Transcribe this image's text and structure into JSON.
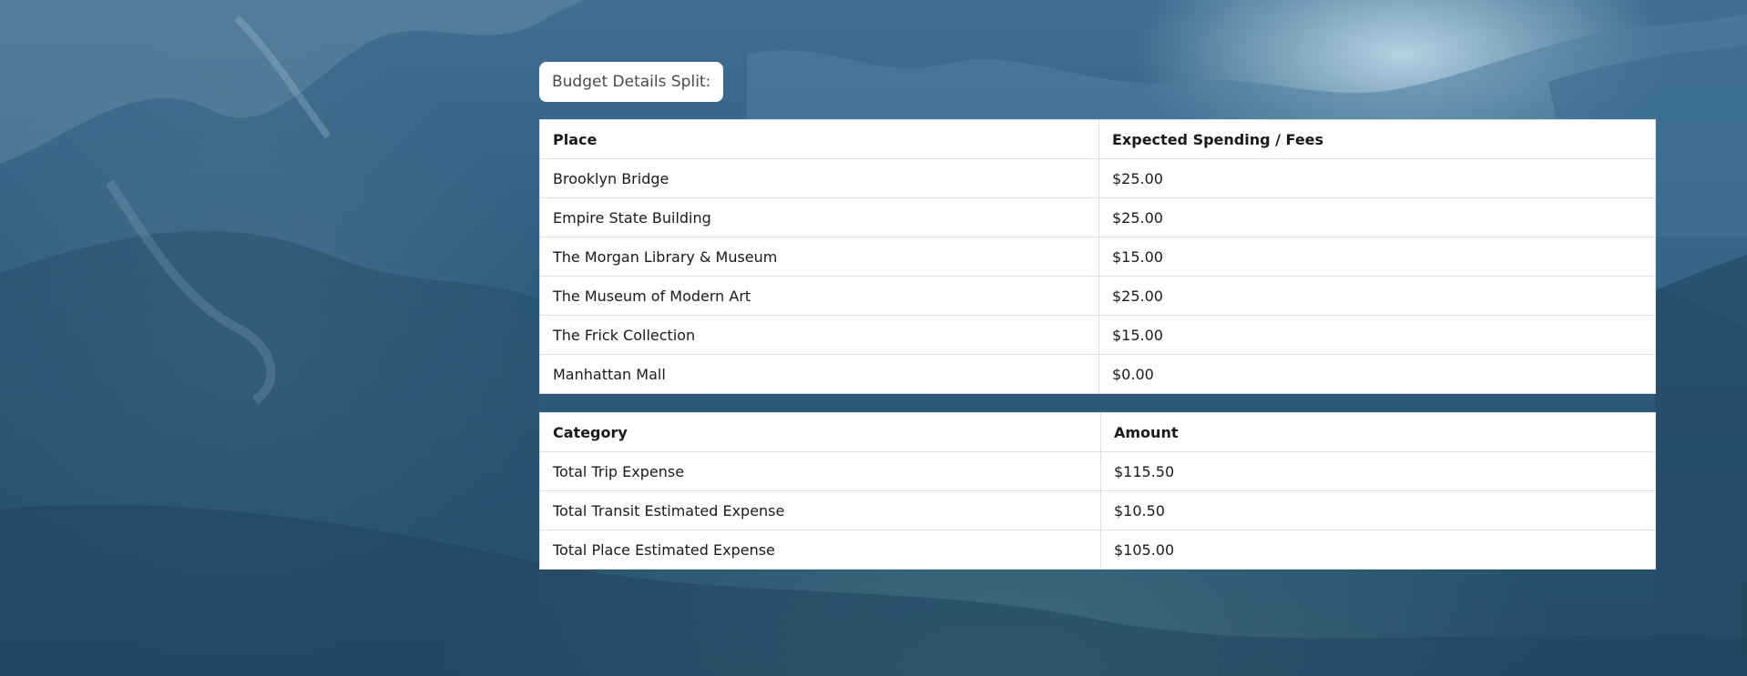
{
  "budget_label": "Budget Details Split:",
  "places_table": {
    "headers": [
      "Place",
      "Expected Spending / Fees"
    ],
    "rows": [
      [
        "Brooklyn Bridge",
        "$25.00"
      ],
      [
        "Empire State Building",
        "$25.00"
      ],
      [
        "The Morgan Library & Museum",
        "$15.00"
      ],
      [
        "The Museum of Modern Art",
        "$25.00"
      ],
      [
        "The Frick Collection",
        "$15.00"
      ],
      [
        "Manhattan Mall",
        "$0.00"
      ]
    ]
  },
  "summary_table": {
    "headers": [
      "Category",
      "Amount"
    ],
    "rows": [
      [
        "Total Trip Expense",
        "$115.50"
      ],
      [
        "Total Transit Estimated Expense",
        "$10.50"
      ],
      [
        "Total Place Estimated Expense",
        "$105.00"
      ]
    ]
  },
  "colors": {
    "sky": "#3f6f93",
    "haze": "#c8e4f0",
    "mountain_dark": "#2a5574",
    "panel": "#ffffff",
    "border": "#dedede"
  }
}
